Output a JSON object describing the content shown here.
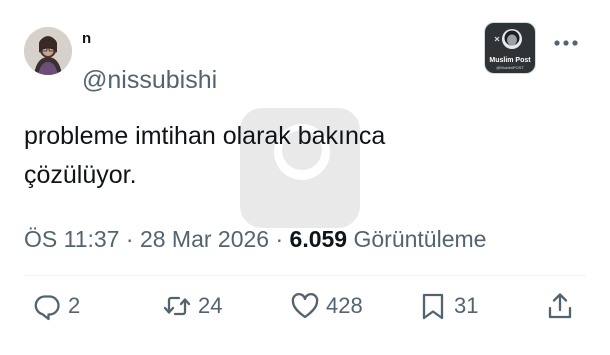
{
  "author": {
    "display_name": "n",
    "handle": "@nissubishi"
  },
  "tweet": {
    "text_line1": "probleme imtihan olarak bakınca",
    "text_line2": "çözülüyor."
  },
  "meta": {
    "time": "ÖS 11:37",
    "separator1": "·",
    "date": "28 Mar 2026",
    "separator2": "·",
    "views": "6.059",
    "views_label": "Görüntüleme"
  },
  "badge": {
    "title": "Muslim Post",
    "subtitle": "@MuslimPOST"
  },
  "actions": {
    "reply_count": "2",
    "retweet_count": "24",
    "like_count": "428",
    "bookmark_count": "31"
  },
  "icons": {
    "more": "more-icon",
    "reply": "reply-icon",
    "retweet": "retweet-icon",
    "like": "heart-icon",
    "bookmark": "bookmark-icon",
    "share": "share-icon"
  },
  "colors": {
    "text": "#0f1419",
    "secondary": "#536471",
    "divider": "#eff3f4"
  }
}
